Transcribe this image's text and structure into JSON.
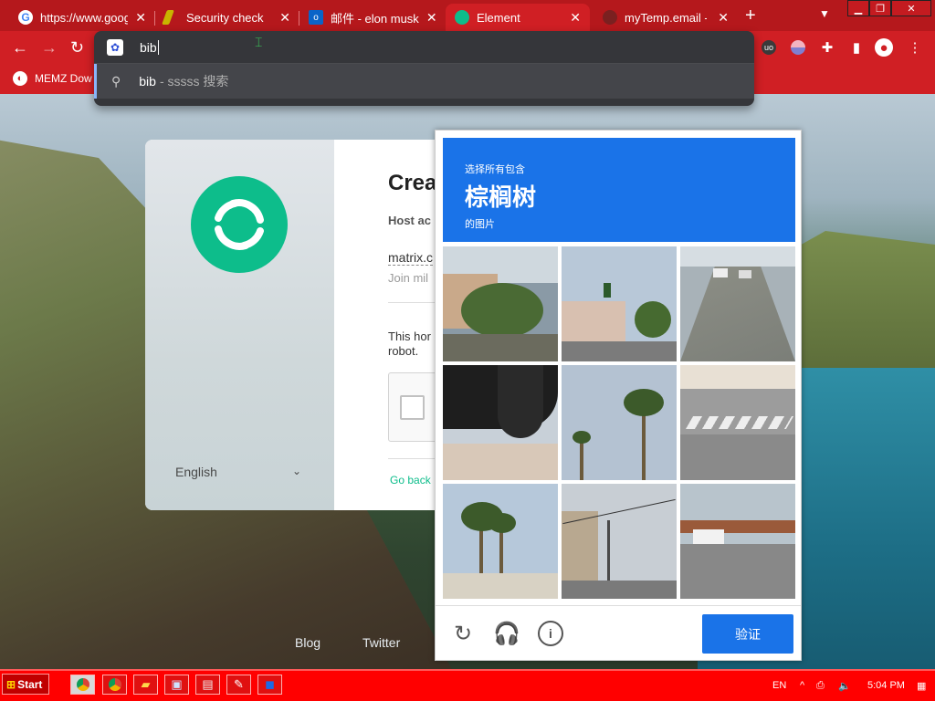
{
  "tabs": [
    {
      "title": "https://www.goog",
      "favicon_color": "#ffffff",
      "active": false
    },
    {
      "title": "Security check",
      "favicon_color": "#c8b400",
      "active": false
    },
    {
      "title": "邮件 - elon musk",
      "favicon_color": "#0a64c8",
      "active": false
    },
    {
      "title": "Element",
      "favicon_color": "#0dbd8b",
      "active": true
    },
    {
      "title": "myTemp.email - T",
      "favicon_color": "#7a2020",
      "active": false
    }
  ],
  "tab_close_glyph": "✕",
  "new_tab_glyph": "+",
  "omnibox": {
    "typed": "bib",
    "suggestion": {
      "query": "bib",
      "detail": "- sssss 搜索"
    }
  },
  "bookmarks": [
    {
      "label": "MEMZ Dow"
    }
  ],
  "element_card": {
    "heading": "Crea",
    "host_label": "Host ac",
    "server": "matrix.c",
    "join": "Join mil",
    "robot_text": "This hor robot.",
    "language": "English",
    "go_back": "Go back"
  },
  "footer_links": [
    "Blog",
    "Twitter"
  ],
  "captcha": {
    "instruction_top": "选择所有包含",
    "target": "棕榈树",
    "instruction_bottom": "的图片",
    "verify_label": "验证",
    "accent": "#1a73e8"
  },
  "taskbar": {
    "start_label": "Start",
    "language": "EN",
    "clock": "5:04 PM"
  },
  "colors": {
    "chrome_red": "#d01f24",
    "taskbar_red": "#ff0000",
    "element_green": "#0dbd8b"
  }
}
